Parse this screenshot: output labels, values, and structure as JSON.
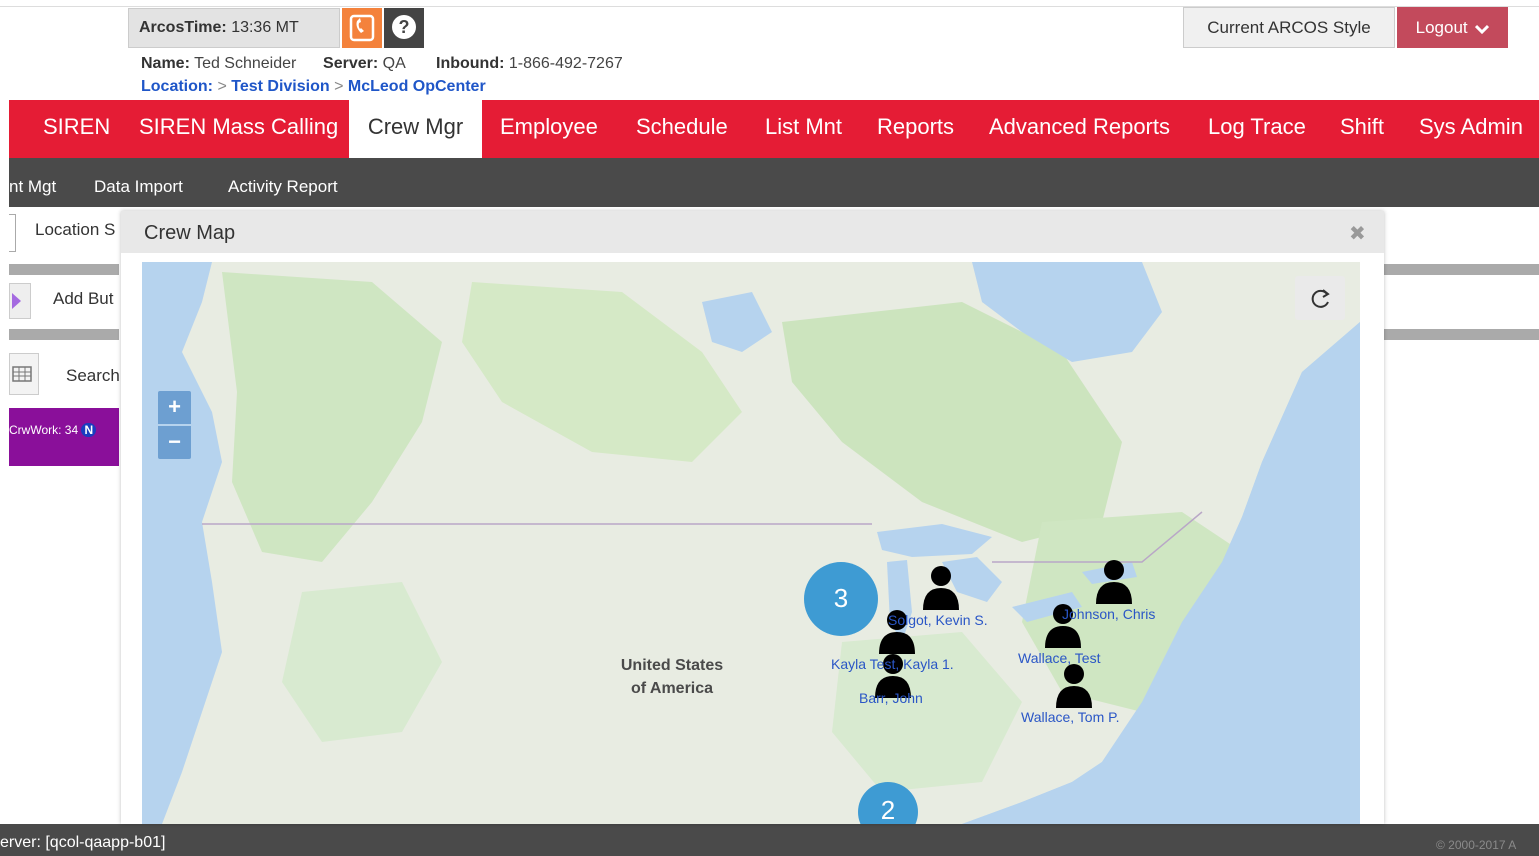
{
  "header": {
    "time_label": "ArcosTime:",
    "time_value": "13:36 MT",
    "name_label": "Name:",
    "name_value": "Ted Schneider",
    "server_label": "Server:",
    "server_value": "QA",
    "inbound_label": "Inbound:",
    "inbound_value": "1-866-492-7267",
    "location_label": "Location:",
    "location_path": [
      "Test Division",
      "McLeod OpCenter"
    ],
    "location_sep": ">",
    "style_button": "Current ARCOS Style",
    "logout_button": "Logout",
    "phone_icon": "phone-icon",
    "help_icon": "question-circle-icon"
  },
  "nav": {
    "items": [
      "SIREN",
      "SIREN Mass Calling",
      "Crew Mgr",
      "Employee",
      "Schedule",
      "List Mnt",
      "Reports",
      "Advanced Reports",
      "Log Trace",
      "Shift",
      "Sys Admin"
    ],
    "active": "Crew Mgr",
    "color": "#e51c35"
  },
  "subnav": {
    "items": [
      "nt Mgt",
      "Data Import",
      "Activity Report"
    ]
  },
  "background_page": {
    "location_label": "Location S",
    "add_label": "Add But",
    "search_label": "Search",
    "badge_text": "CrwWork: 34",
    "badge_n": "N"
  },
  "modal": {
    "title": "Crew Map",
    "close_icon": "close-icon",
    "refresh_icon": "refresh-icon"
  },
  "map": {
    "zoom_in": "+",
    "zoom_out": "−",
    "country_label": [
      "United States",
      "of America"
    ],
    "clusters": [
      "3",
      "2"
    ],
    "people": [
      "Solgot, Kevin S.",
      "Johnson, Chris",
      "Kayla Test, Kayla 1.",
      "Wallace, Test",
      "Barr, John",
      "Wallace, Tom P."
    ]
  },
  "footer": {
    "server": "erver: [qcol-qaapp-b01]",
    "copyright": "© 2000-2017 A"
  }
}
